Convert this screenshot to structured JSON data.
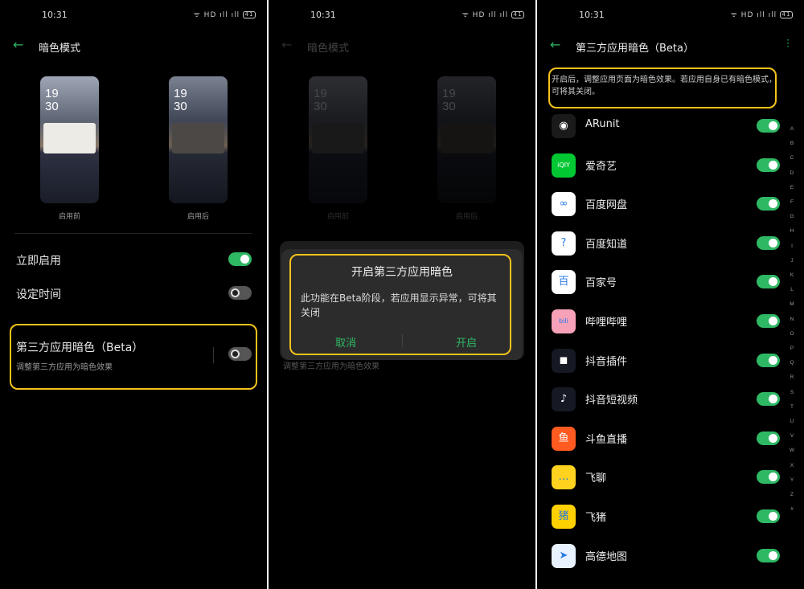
{
  "status": {
    "time": "10:31",
    "icons": "ᯤ HD ıll ıll",
    "battery": "41"
  },
  "panel1": {
    "title": "暗色模式",
    "preview_before": {
      "clock_h": "19",
      "clock_m": "30",
      "label": "启用前"
    },
    "preview_after": {
      "clock_h": "19",
      "clock_m": "30",
      "label": "启用后"
    },
    "rows": {
      "enable_now": "立即启用",
      "schedule": "设定时间",
      "third_party": "第三方应用暗色（Beta）",
      "third_party_sub": "调整第三方应用为暗色效果"
    }
  },
  "panel2": {
    "title": "暗色模式",
    "dialog": {
      "title": "开启第三方应用暗色",
      "message": "此功能在Beta阶段，若应用显示异常，可将其关闭",
      "cancel": "取消",
      "confirm": "开启"
    },
    "underlying_sub": "调整第三方应用为暗色效果"
  },
  "panel3": {
    "title": "第三方应用暗色（Beta）",
    "description": "开启后，调整应用页面为暗色效果。若应用自身已有暗色模式，可将其关闭。",
    "apps": [
      {
        "name": "ARunit",
        "glyph": "◉",
        "color": "#1a1a1a"
      },
      {
        "name": "爱奇艺",
        "glyph": "iQIY",
        "color": "#00c732"
      },
      {
        "name": "百度网盘",
        "glyph": "∞",
        "color": "#ffffff"
      },
      {
        "name": "百度知道",
        "glyph": "?",
        "color": "#ffffff"
      },
      {
        "name": "百家号",
        "glyph": "百",
        "color": "#ffffff"
      },
      {
        "name": "哔哩哔哩",
        "glyph": "bili",
        "color": "#f7a1b9"
      },
      {
        "name": "抖音插件",
        "glyph": "◼",
        "color": "#161823"
      },
      {
        "name": "抖音短视频",
        "glyph": "♪",
        "color": "#161823"
      },
      {
        "name": "斗鱼直播",
        "glyph": "鱼",
        "color": "#ff5a1f"
      },
      {
        "name": "飞聊",
        "glyph": "…",
        "color": "#ffd21f"
      },
      {
        "name": "飞猪",
        "glyph": "猪",
        "color": "#ffd000"
      },
      {
        "name": "高德地图",
        "glyph": "➤",
        "color": "#e8f2ff"
      }
    ],
    "index_letters": [
      "A",
      "B",
      "C",
      "D",
      "E",
      "F",
      "G",
      "H",
      "I",
      "J",
      "K",
      "L",
      "M",
      "N",
      "O",
      "P",
      "Q",
      "R",
      "S",
      "T",
      "U",
      "V",
      "W",
      "X",
      "Y",
      "Z",
      "#"
    ]
  },
  "colors": {
    "accent": "#2fb864",
    "highlight": "#f4c31b",
    "background": "#000000"
  }
}
